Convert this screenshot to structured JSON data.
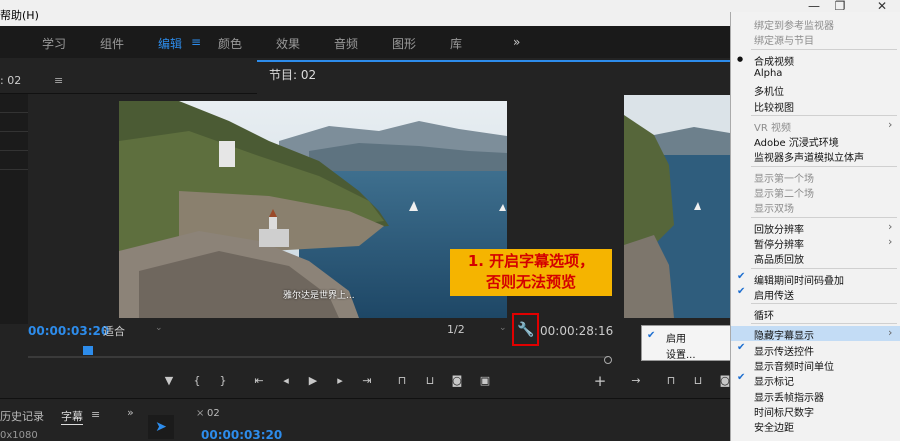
{
  "menubar": {
    "help": "帮助(H)"
  },
  "workspace_tabs": [
    "学习",
    "组件",
    "编辑",
    "颜色",
    "效果",
    "音频",
    "图形",
    "库"
  ],
  "workspace_active": "编辑",
  "workspace_more": "»",
  "source_panel": {
    "label": ": 02"
  },
  "program_monitor": {
    "title": "节目: 02",
    "subtitle_overlay": "雅尔达是世界上...",
    "timecode_current": "00:00:03:20",
    "fit_label": "适合",
    "resolution_label": "1/2",
    "timecode_duration": "00:00:28:16"
  },
  "annotation": {
    "line1": "1. 开启字幕选项，",
    "line2": "否则无法预览",
    "color": "#f5b400"
  },
  "settings_popup": {
    "items": [
      {
        "label": "启用",
        "checked": true
      },
      {
        "label": "设置...",
        "checked": false
      }
    ]
  },
  "bottom": {
    "history_tab": "历史记录",
    "captions_tab": "字幕",
    "more": "»",
    "resolution_text": "0x1080",
    "seq_close": "×",
    "seq_tab": "02",
    "seq_timecode": "00:00:03:20"
  },
  "context_menu": {
    "items": [
      {
        "label": "绑定到参考监视器",
        "state": "disabled"
      },
      {
        "label": "绑定源与节目",
        "state": "disabled"
      },
      {
        "sep": true
      },
      {
        "label": "合成视频",
        "state": "bullet"
      },
      {
        "label": "Alpha",
        "state": "normal"
      },
      {
        "label": "多机位",
        "state": "normal"
      },
      {
        "label": "比较视图",
        "state": "normal"
      },
      {
        "sep": true
      },
      {
        "label": "VR 视频",
        "state": "disabled",
        "submenu": true
      },
      {
        "label": "Adobe 沉浸式环境",
        "state": "normal"
      },
      {
        "label": "监视器多声道模拟立体声",
        "state": "normal"
      },
      {
        "sep": true
      },
      {
        "label": "显示第一个场",
        "state": "disabled"
      },
      {
        "label": "显示第二个场",
        "state": "disabled"
      },
      {
        "label": "显示双场",
        "state": "disabled"
      },
      {
        "sep": true
      },
      {
        "label": "回放分辨率",
        "state": "normal",
        "submenu": true
      },
      {
        "label": "暂停分辨率",
        "state": "normal",
        "submenu": true
      },
      {
        "label": "高品质回放",
        "state": "normal"
      },
      {
        "sep": true
      },
      {
        "label": "编辑期间时间码叠加",
        "state": "checked"
      },
      {
        "label": "启用传送",
        "state": "checked"
      },
      {
        "sep": true
      },
      {
        "label": "循环",
        "state": "normal"
      },
      {
        "sep": true
      },
      {
        "label": "隐藏字幕显示",
        "state": "highlight",
        "submenu": true
      },
      {
        "label": "显示传送控件",
        "state": "checked"
      },
      {
        "label": "显示音频时间单位",
        "state": "normal"
      },
      {
        "label": "显示标记",
        "state": "checked"
      },
      {
        "label": "显示丢帧指示器",
        "state": "normal"
      },
      {
        "label": "时间标尺数字",
        "state": "normal"
      },
      {
        "label": "安全边距",
        "state": "normal"
      }
    ]
  },
  "colors": {
    "accent": "#2d8ceb",
    "highlight_box": "#e00000",
    "annotation_text": "#d40000"
  }
}
